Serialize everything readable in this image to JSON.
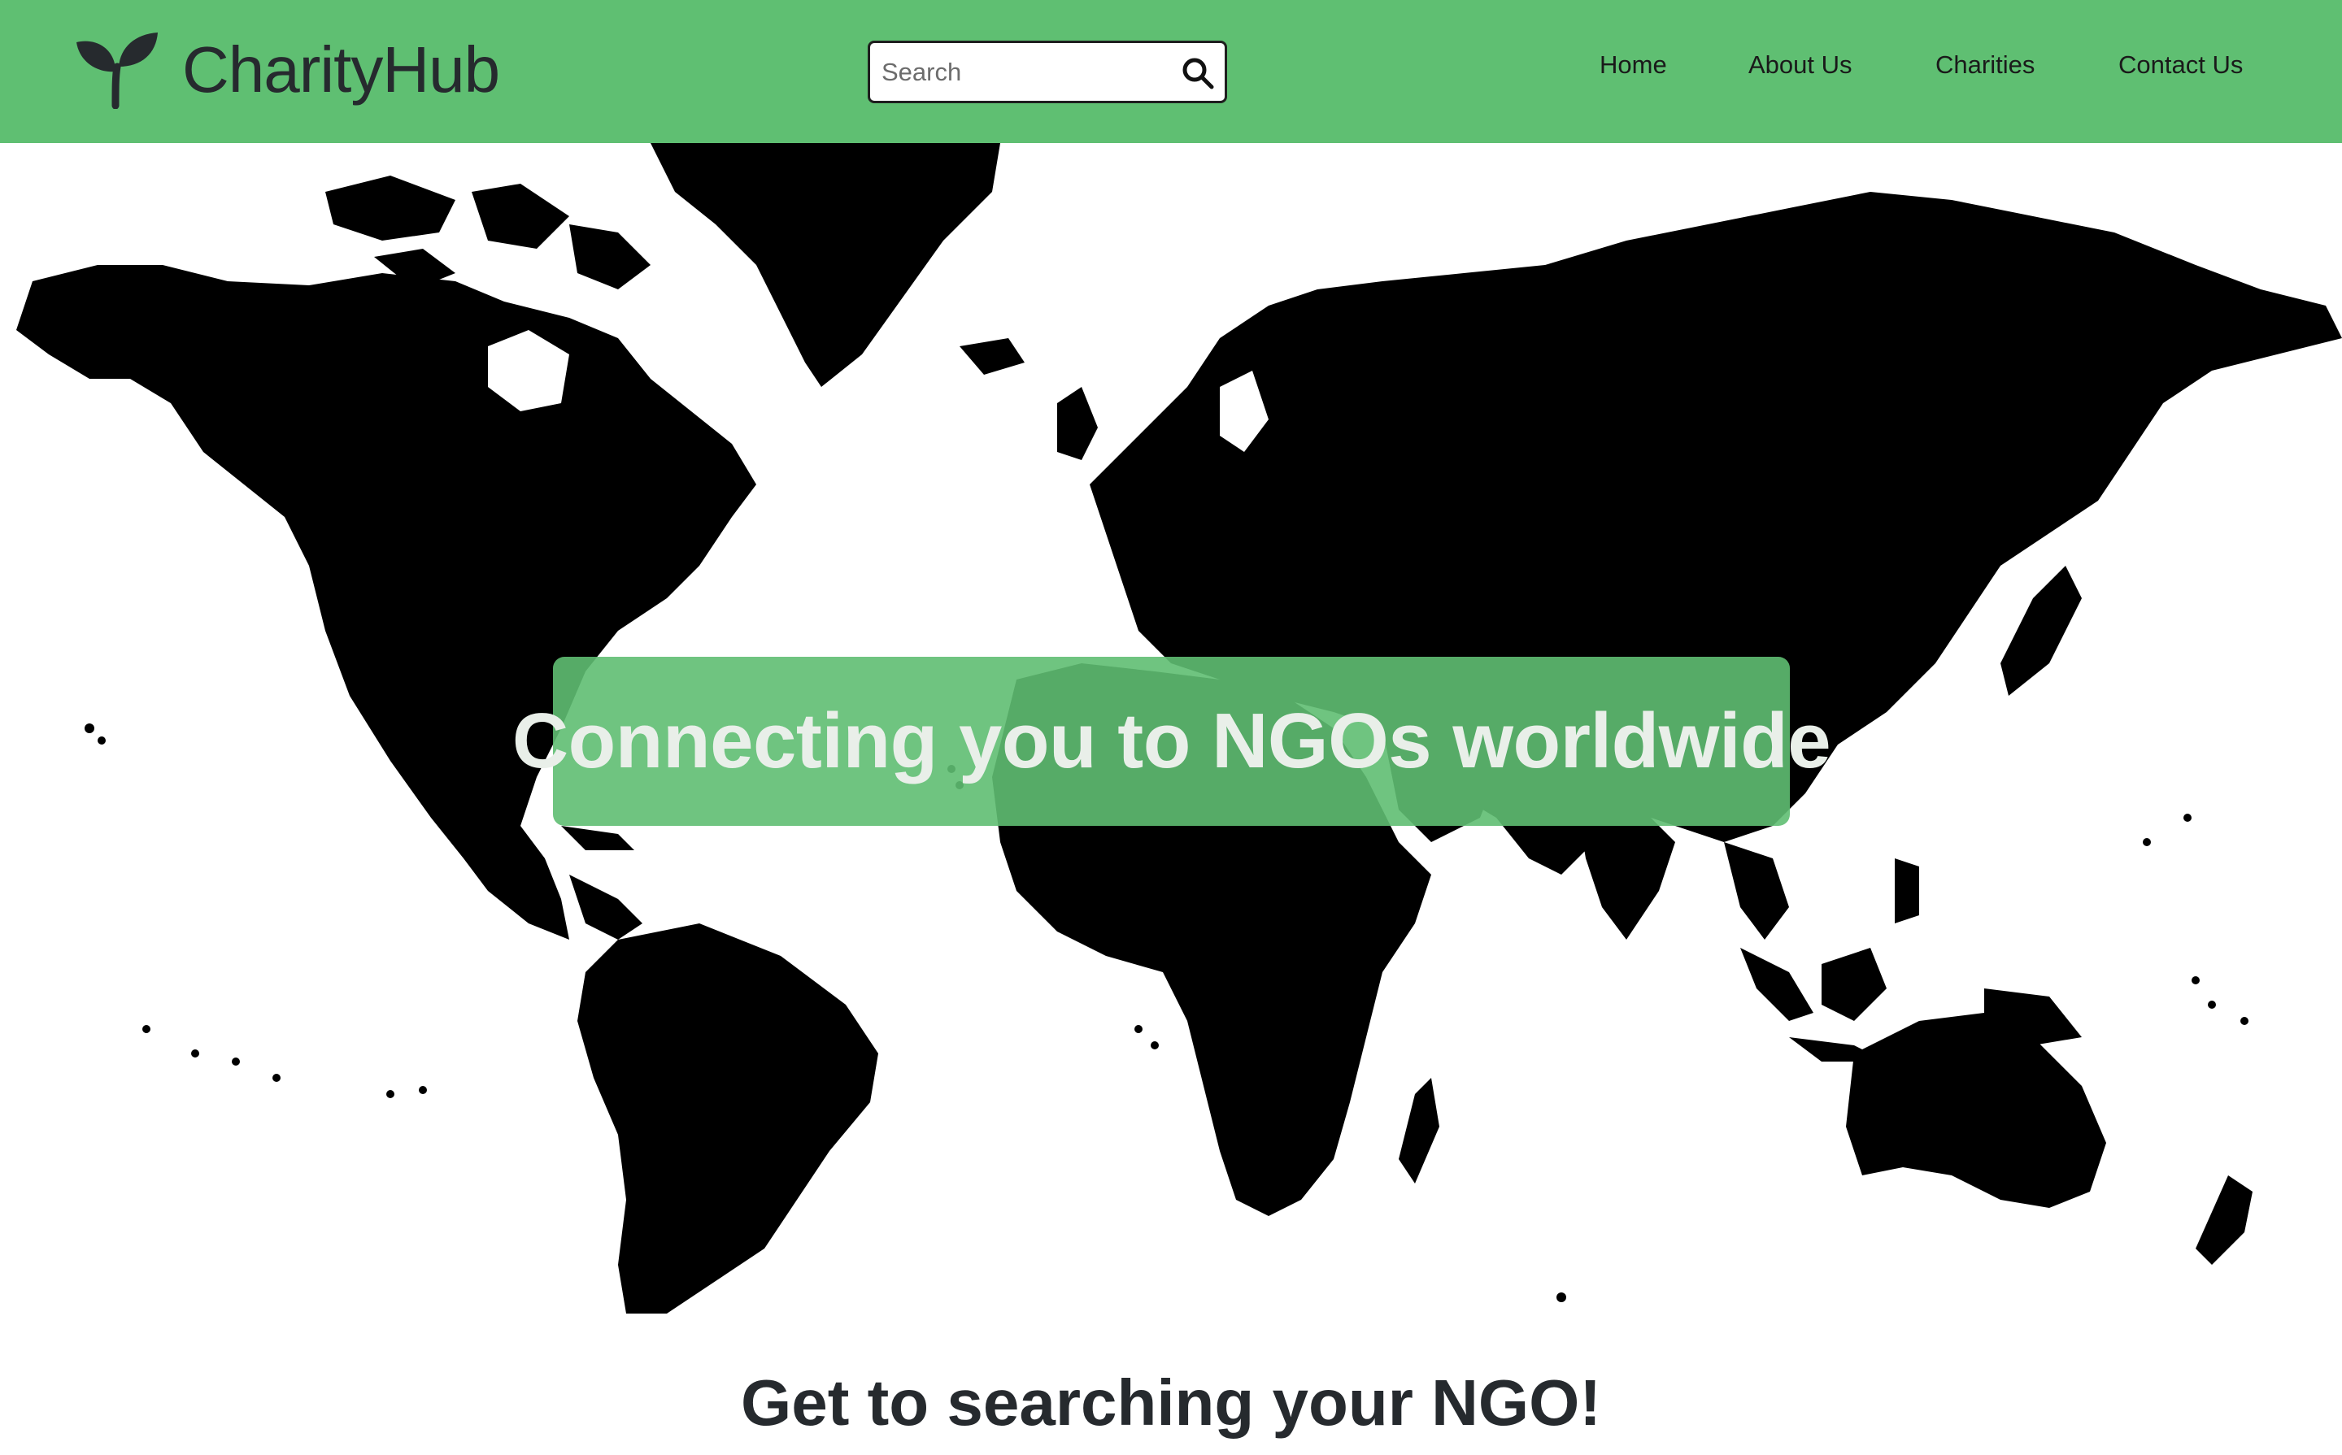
{
  "colors": {
    "navbar_bg": "#5fbf72",
    "banner_bg": "#5fbe72",
    "text_dark": "#262a2e",
    "map_land": "#000000"
  },
  "header": {
    "brand": {
      "name": "CharityHub",
      "icon": "sprout-icon"
    },
    "search": {
      "placeholder": "Search",
      "value": "",
      "icon": "search-icon"
    },
    "nav": [
      {
        "label": "Home"
      },
      {
        "label": "About Us"
      },
      {
        "label": "Charities"
      },
      {
        "label": "Contact Us"
      }
    ]
  },
  "hero": {
    "background": "world-map",
    "title": "Connecting you to NGOs worldwide"
  },
  "section": {
    "heading": "Get to searching your NGO!"
  }
}
